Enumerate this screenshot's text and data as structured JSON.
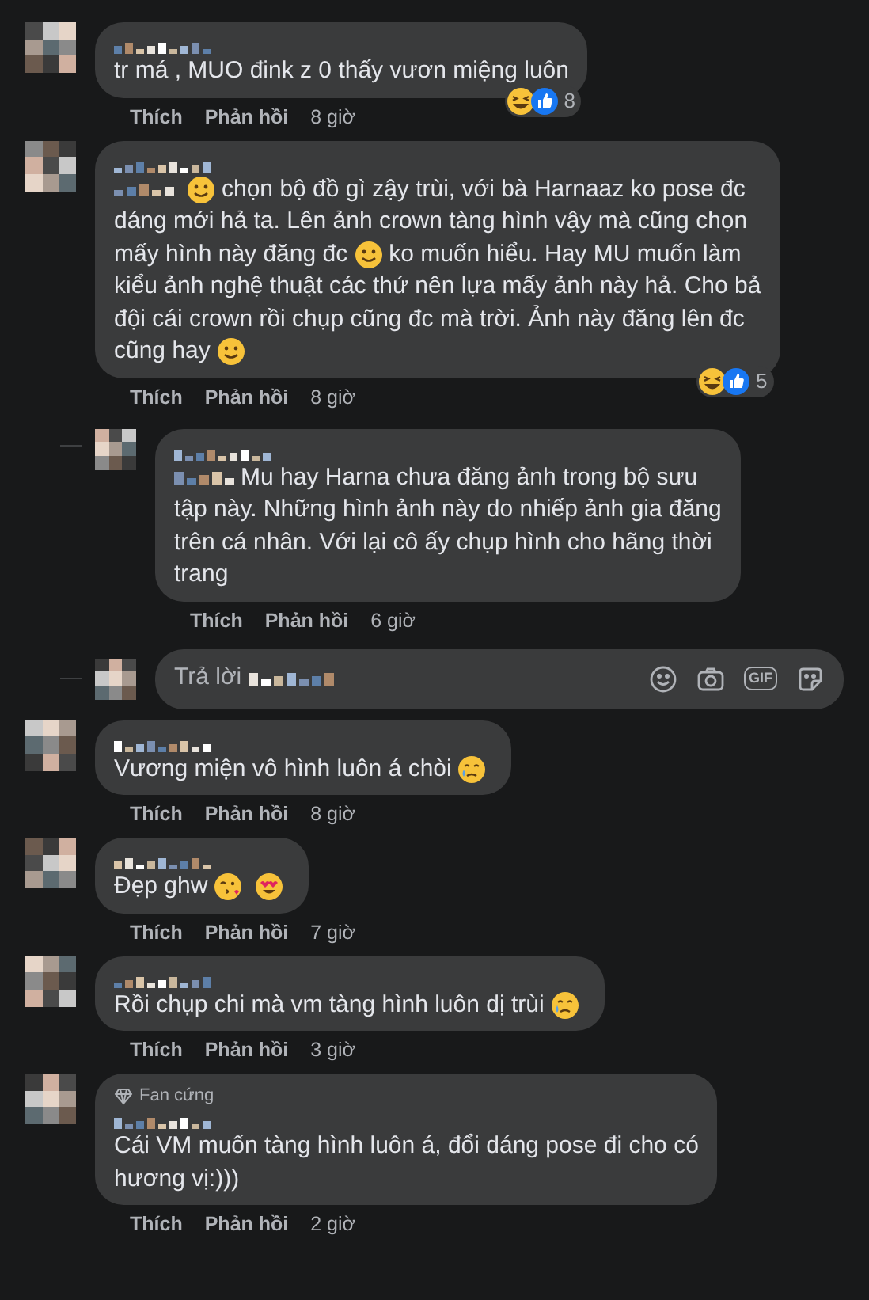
{
  "comments": [
    {
      "lines": [
        [
          {
            "kind": "text",
            "text": "tr má , MUO đink z 0 thấy vươn miệng luôn"
          }
        ]
      ],
      "reactions": {
        "count": "8"
      },
      "actions": {
        "like": "Thích",
        "reply": "Phản hồi",
        "time": "8 giờ"
      }
    },
    {
      "lines": [
        [
          {
            "kind": "mention"
          },
          {
            "kind": "smile"
          },
          {
            "kind": "text",
            "text": "chọn bộ đồ gì zậy trùi, với bà Harnaaz ko pose đc"
          }
        ],
        [
          {
            "kind": "text",
            "text": "dáng mới hả ta. Lên ảnh crown tàng hình vậy mà cũng chọn"
          }
        ],
        [
          {
            "kind": "text",
            "text": "mấy hình này đăng đc"
          },
          {
            "kind": "smile"
          },
          {
            "kind": "text",
            "text": "ko muốn hiểu. Hay MU muốn làm"
          }
        ],
        [
          {
            "kind": "text",
            "text": "kiểu ảnh nghệ thuật các thứ nên lựa mấy ảnh này hả. Cho bả"
          }
        ],
        [
          {
            "kind": "text",
            "text": "đội cái crown rồi chụp cũng đc mà trời. Ảnh này đăng lên đc"
          }
        ],
        [
          {
            "kind": "text",
            "text": "cũng hay"
          },
          {
            "kind": "smile"
          }
        ]
      ],
      "reactions": {
        "count": "5"
      },
      "actions": {
        "like": "Thích",
        "reply": "Phản hồi",
        "time": "8 giờ"
      },
      "replies": [
        {
          "lines": [
            [
              {
                "kind": "mention"
              },
              {
                "kind": "text",
                "text": "Mu hay Harna chưa đăng ảnh trong bộ sưu"
              }
            ],
            [
              {
                "kind": "text",
                "text": "tập này. Những hình ảnh này do nhiếp ảnh gia đăng"
              }
            ],
            [
              {
                "kind": "text",
                "text": "trên cá nhân. Với lại cô ấy chụp hình cho hãng thời"
              }
            ],
            [
              {
                "kind": "text",
                "text": "trang"
              }
            ]
          ],
          "actions": {
            "like": "Thích",
            "reply": "Phản hồi",
            "time": "6 giờ"
          }
        }
      ],
      "reply_box": {
        "placeholder": "Trả lời",
        "gif_label": "GIF"
      }
    },
    {
      "lines": [
        [
          {
            "kind": "text",
            "text": "Vương miện vô hình luôn á chòi"
          },
          {
            "kind": "tear"
          }
        ]
      ],
      "actions": {
        "like": "Thích",
        "reply": "Phản hồi",
        "time": "8 giờ"
      }
    },
    {
      "lines": [
        [
          {
            "kind": "text",
            "text": "Đẹp ghw"
          },
          {
            "kind": "kiss"
          },
          {
            "kind": "hearteyes"
          }
        ]
      ],
      "actions": {
        "like": "Thích",
        "reply": "Phản hồi",
        "time": "7 giờ"
      }
    },
    {
      "lines": [
        [
          {
            "kind": "text",
            "text": "Rồi chụp chi mà vm tàng hình luôn dị trùi"
          },
          {
            "kind": "tear"
          }
        ]
      ],
      "actions": {
        "like": "Thích",
        "reply": "Phản hồi",
        "time": "3 giờ"
      }
    },
    {
      "badge": "Fan cứng",
      "lines": [
        [
          {
            "kind": "text",
            "text": "Cái VM muốn tàng hình luôn á, đổi dáng pose đi cho có"
          }
        ],
        [
          {
            "kind": "text",
            "text": "hương vị:)))"
          }
        ]
      ],
      "actions": {
        "like": "Thích",
        "reply": "Phản hồi",
        "time": "2 giờ"
      }
    }
  ]
}
